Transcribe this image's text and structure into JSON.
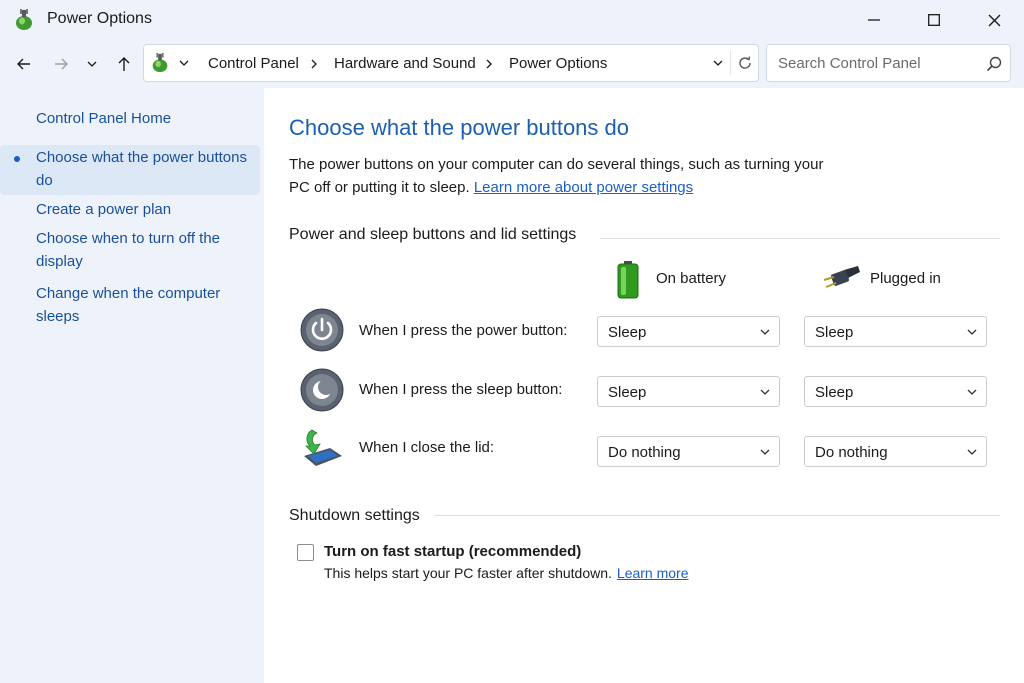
{
  "window": {
    "title": "Power Options"
  },
  "toolbar": {
    "breadcrumbs": [
      "Control Panel",
      "Hardware and Sound",
      "Power Options"
    ],
    "search_placeholder": "Search Control Panel"
  },
  "sidebar": {
    "items": [
      {
        "label": "Control Panel Home"
      },
      {
        "label": "Choose what the power buttons do",
        "active": true
      },
      {
        "label": "Create a power plan"
      },
      {
        "label": "Choose when to turn off the display"
      },
      {
        "label": "Change when the computer sleeps"
      }
    ]
  },
  "main": {
    "title": "Choose what the power buttons do",
    "description": "The power buttons on your computer can do several things, such as turning your PC off or putting it to sleep.",
    "learn_more_link": "Learn more about power settings",
    "section_buttons": "Power and sleep buttons and lid settings",
    "columns": {
      "battery": "On battery",
      "plugged": "Plugged in"
    },
    "rows": [
      {
        "label": "When I press the power button:",
        "battery": "Sleep",
        "plugged": "Sleep",
        "icon": "power-button-icon"
      },
      {
        "label": "When I press the sleep button:",
        "battery": "Sleep",
        "plugged": "Sleep",
        "icon": "sleep-button-icon"
      },
      {
        "label": "When I close the lid:",
        "battery": "Do nothing",
        "plugged": "Do nothing",
        "icon": "laptop-lid-icon"
      }
    ],
    "section_shutdown": "Shutdown settings",
    "fast_startup": {
      "label": "Turn on fast startup (recommended)",
      "help": "This helps start your PC faster after shutdown.",
      "link": "Learn more",
      "checked": false
    }
  },
  "colors": {
    "accent": "#1a5fc4",
    "title_blue": "#1a5fb4",
    "sidebar_bg": "#eef3fb"
  }
}
